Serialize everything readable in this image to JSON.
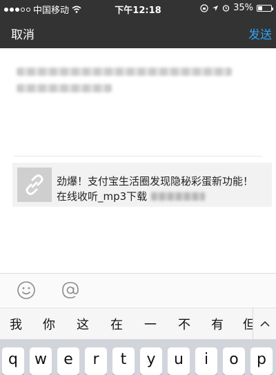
{
  "status_bar": {
    "carrier": "中国移动",
    "time": "下午12:18",
    "battery_percent": "35%",
    "battery_level": 0.35
  },
  "nav": {
    "cancel_label": "取消",
    "send_label": "发送",
    "send_color": "#2fa3f3"
  },
  "link_card": {
    "title": "劲爆！支付宝生活圈发现隐秘彩蛋新功能！",
    "subtitle": "在线收听_mp3下载"
  },
  "toolbar": {
    "icons": [
      "smiley-icon",
      "at-icon"
    ]
  },
  "candidates": {
    "items": [
      "我",
      "你",
      "这",
      "在",
      "一",
      "不",
      "有",
      "但"
    ]
  },
  "keyboard": {
    "keys": [
      "q",
      "w",
      "e",
      "r",
      "t",
      "y",
      "u",
      "i",
      "o",
      "p"
    ]
  }
}
